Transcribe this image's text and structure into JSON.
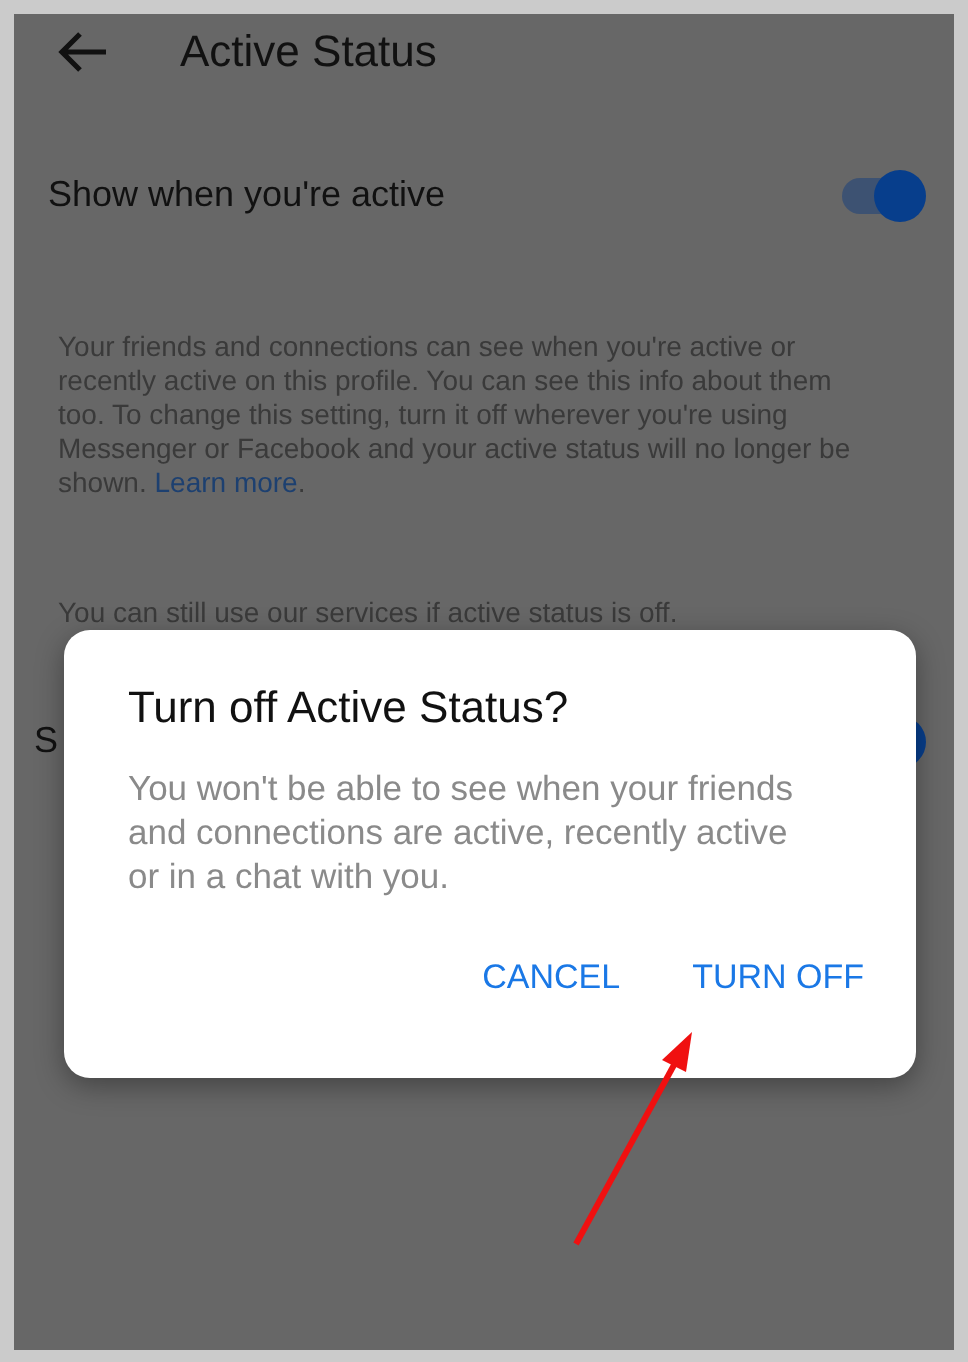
{
  "header": {
    "title": "Active Status"
  },
  "settings": [
    {
      "label": "Show when you're active",
      "on": true
    },
    {
      "label": "S",
      "on": true
    }
  ],
  "description": {
    "text": "Your friends and connections can see when you're active or recently active on this profile. You can see this info about them too. To change this setting, turn it off wherever you're using Messenger or Facebook and your active status will no longer be shown.",
    "link": "Learn more",
    "after": "."
  },
  "note": "You can still use our services if active status is off.",
  "dialog": {
    "title": "Turn off Active Status?",
    "message": "You won't be able to see when your friends and connections are active, recently active or in a chat with you.",
    "buttons": [
      "CANCEL",
      "TURN OFF"
    ]
  }
}
